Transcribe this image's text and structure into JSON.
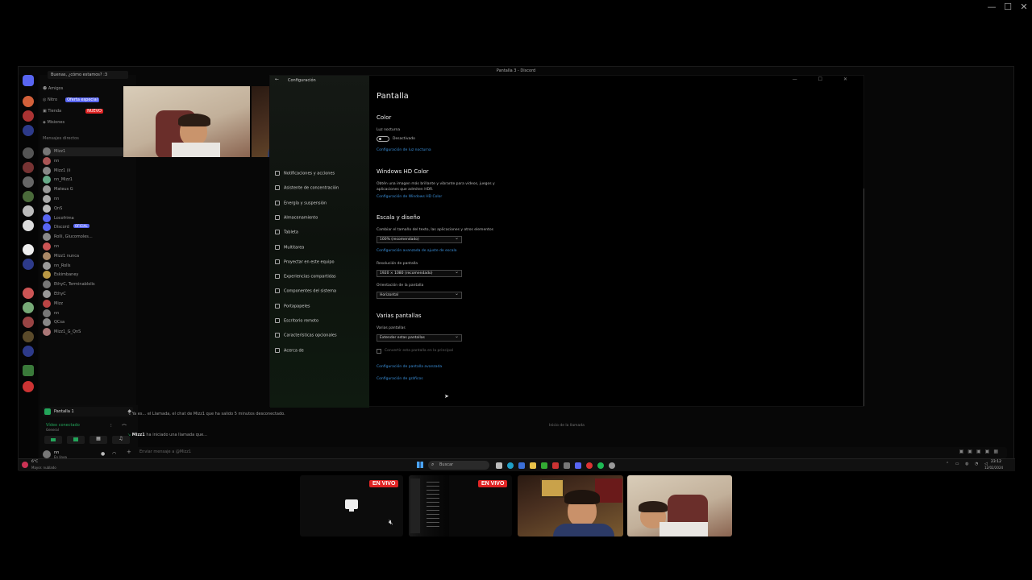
{
  "window": {
    "controls": [
      "—",
      "☐",
      "✕"
    ]
  },
  "discord": {
    "window_title": "Pantalla 3 - Discord",
    "server_banner": "Buenas, ¿cómo estamos? :3",
    "menu": [
      "Amigos",
      "Nitro",
      "Tienda",
      "Misiones"
    ],
    "nitro_badge": "Oferta especial",
    "new_badge": "NUEVO",
    "dm_header": "Mensajes directos",
    "dms": [
      "Mizz1",
      "nn",
      "Mizz1 (ii",
      "nn_Mizz1",
      "Mateus G",
      "nn",
      "QnS",
      "Locofrima",
      "Discord",
      "Rolli, Glucomoles...",
      "nn",
      "Mizz1 nunca",
      "nn_Rolls",
      "Eskimbaney",
      "EthyC, Terminablolis",
      "EthyC",
      "Mizz",
      "nn",
      "QCsa",
      "Mizz1_G_QnS"
    ],
    "discord_badge": "OFICIAL",
    "active_channel": "Pantalla 1",
    "voice_status": "Vídeo conectado",
    "voice_sub": "General",
    "user_name": "nn",
    "user_status": "En línea"
  },
  "settings": {
    "app_title": "Configuración",
    "nav": [
      "Notificaciones y acciones",
      "Asistente de concentración",
      "Energía y suspensión",
      "Almacenamiento",
      "Tableta",
      "Multitarea",
      "Proyectar en este equipo",
      "Experiencias compartidas",
      "Componentes del sistema",
      "Portapapeles",
      "Escritorio remoto",
      "Características opcionales",
      "Acerca de"
    ],
    "page_title": "Pantalla",
    "color_header": "Color",
    "night_light": "Luz nocturna",
    "night_light_state": "Desactivado",
    "night_light_link": "Configuración de luz nocturna",
    "hdr_header": "Windows HD Color",
    "hdr_desc_1": "Obtén una imagen más brillante y vibrante para vídeos, juegos y",
    "hdr_desc_2": "aplicaciones que admiten HDR.",
    "hdr_link": "Configuración de Windows HD Color",
    "scale_header": "Escala y diseño",
    "scale_label": "Cambiar el tamaño del texto, las aplicaciones y otros elementos",
    "scale_value": "100% (recomendado)",
    "scale_link": "Configuración avanzada de ajuste de escala",
    "res_label": "Resolución de pantalla",
    "res_value": "1920 × 1080 (recomendado)",
    "orient_label": "Orientación de la pantalla",
    "orient_value": "Horizontal",
    "multi_header": "Varias pantallas",
    "multi_label": "Varias pantallas",
    "multi_value": "Extender estas pantallas",
    "main_display": "Convertir esta pantalla en la principal",
    "adv_link": "Configuración de pantalla avanzada",
    "gfx_link": "Configuración de gráficos"
  },
  "chat": {
    "line1": "Ya es... el Llamada, el chat de Mizz1 que ha salido 5 minutos desconectado.",
    "line2_user": "Mizz1",
    "line2": "ha iniciado una llamada que...",
    "center_note": "Inicio de la llamada",
    "input_placeholder": "Enviar mensaje a @Mizz1"
  },
  "taskbar": {
    "search": "Buscar",
    "weather": "6°C",
    "weather_sub": "Mayor. nublado",
    "time": "23:12",
    "date": "12/02/2024"
  },
  "strip": {
    "live_label": "EN VIVO"
  },
  "colors": {
    "accent": "#3a8fd9",
    "live": "#e02424",
    "discord": "#5865f2",
    "green": "#23a55a"
  }
}
